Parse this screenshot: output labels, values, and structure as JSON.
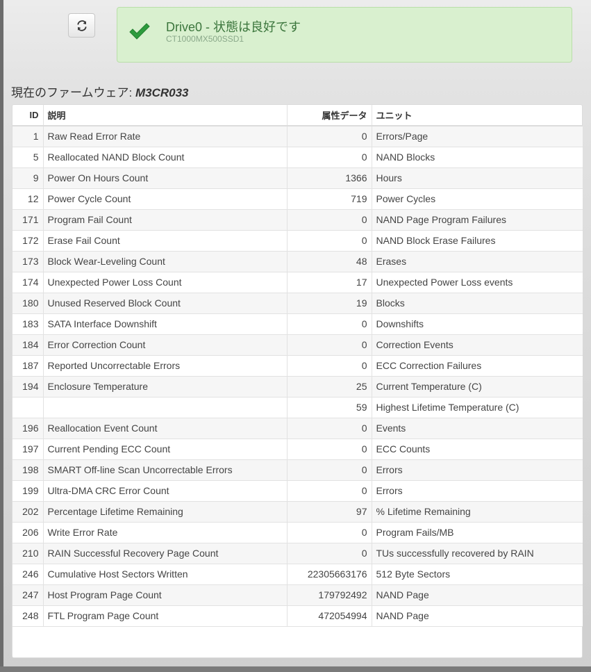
{
  "status": {
    "title": "Drive0 - 状態は良好です",
    "model": "CT1000MX500SSD1",
    "color": "#3c763d"
  },
  "toolbar": {
    "refresh_icon": "refresh-icon"
  },
  "firmware": {
    "label": "現在のファームウェア:",
    "version": "M3CR033"
  },
  "table": {
    "headers": {
      "id": "ID",
      "desc": "説明",
      "value": "属性データ",
      "unit": "ユニット"
    },
    "rows": [
      {
        "id": "1",
        "desc": "Raw Read Error Rate",
        "value": "0",
        "unit": "Errors/Page"
      },
      {
        "id": "5",
        "desc": "Reallocated NAND Block Count",
        "value": "0",
        "unit": "NAND Blocks"
      },
      {
        "id": "9",
        "desc": "Power On Hours Count",
        "value": "1366",
        "unit": "Hours"
      },
      {
        "id": "12",
        "desc": "Power Cycle Count",
        "value": "719",
        "unit": "Power Cycles"
      },
      {
        "id": "171",
        "desc": "Program Fail Count",
        "value": "0",
        "unit": "NAND Page Program Failures"
      },
      {
        "id": "172",
        "desc": "Erase Fail Count",
        "value": "0",
        "unit": "NAND Block Erase Failures"
      },
      {
        "id": "173",
        "desc": "Block Wear-Leveling Count",
        "value": "48",
        "unit": "Erases"
      },
      {
        "id": "174",
        "desc": "Unexpected Power Loss Count",
        "value": "17",
        "unit": "Unexpected Power Loss events"
      },
      {
        "id": "180",
        "desc": "Unused Reserved Block Count",
        "value": "19",
        "unit": "Blocks"
      },
      {
        "id": "183",
        "desc": "SATA Interface Downshift",
        "value": "0",
        "unit": "Downshifts"
      },
      {
        "id": "184",
        "desc": "Error Correction Count",
        "value": "0",
        "unit": "Correction Events"
      },
      {
        "id": "187",
        "desc": "Reported Uncorrectable Errors",
        "value": "0",
        "unit": "ECC Correction Failures"
      },
      {
        "id": "194",
        "desc": "Enclosure Temperature",
        "value": "25",
        "unit": "Current Temperature (C)"
      },
      {
        "id": "",
        "desc": "",
        "value": "59",
        "unit": "Highest Lifetime Temperature (C)"
      },
      {
        "id": "196",
        "desc": "Reallocation Event Count",
        "value": "0",
        "unit": "Events"
      },
      {
        "id": "197",
        "desc": "Current Pending ECC Count",
        "value": "0",
        "unit": "ECC Counts"
      },
      {
        "id": "198",
        "desc": "SMART Off-line Scan Uncorrectable Errors",
        "value": "0",
        "unit": "Errors"
      },
      {
        "id": "199",
        "desc": "Ultra-DMA CRC Error Count",
        "value": "0",
        "unit": "Errors"
      },
      {
        "id": "202",
        "desc": "Percentage Lifetime Remaining",
        "value": "97",
        "unit": "% Lifetime Remaining"
      },
      {
        "id": "206",
        "desc": "Write Error Rate",
        "value": "0",
        "unit": "Program Fails/MB"
      },
      {
        "id": "210",
        "desc": "RAIN Successful Recovery Page Count",
        "value": "0",
        "unit": "TUs successfully recovered by RAIN"
      },
      {
        "id": "246",
        "desc": "Cumulative Host Sectors Written",
        "value": "22305663176",
        "unit": "512 Byte Sectors"
      },
      {
        "id": "247",
        "desc": "Host Program Page Count",
        "value": "179792492",
        "unit": "NAND Page"
      },
      {
        "id": "248",
        "desc": "FTL Program Page Count",
        "value": "472054994",
        "unit": "NAND Page"
      }
    ]
  }
}
